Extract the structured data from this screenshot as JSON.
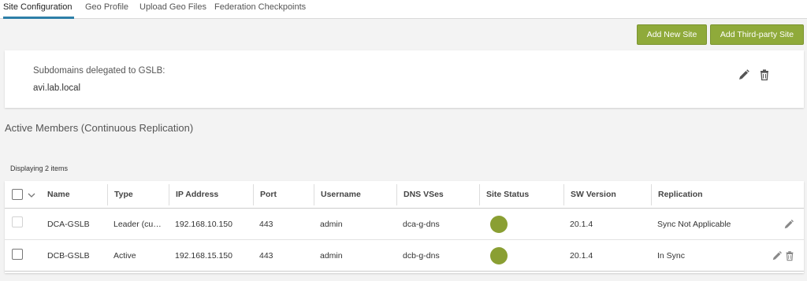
{
  "tabs": [
    {
      "label": "Site Configuration",
      "active": true
    },
    {
      "label": "Geo Profile",
      "active": false
    },
    {
      "label": "Upload Geo Files",
      "active": false
    },
    {
      "label": "Federation Checkpoints",
      "active": false
    }
  ],
  "actions": {
    "add_new_site": "Add New Site",
    "add_third_party_site": "Add Third-party Site"
  },
  "subdomains": {
    "label": "Subdomains delegated to GSLB:",
    "value": "avi.lab.local"
  },
  "section_title": "Active Members (Continuous Replication)",
  "display_count": "Displaying 2 items",
  "table": {
    "columns": [
      "Name",
      "Type",
      "IP Address",
      "Port",
      "Username",
      "DNS VSes",
      "Site Status",
      "SW Version",
      "Replication"
    ],
    "rows": [
      {
        "name": "DCA-GSLB",
        "type": "Leader (current)",
        "ip": "192.168.10.150",
        "port": "443",
        "username": "admin",
        "dns_vses": "dca-g-dns",
        "site_status": "up",
        "sw_version": "20.1.4",
        "replication": "Sync Not Applicable",
        "checkbox_disabled": true,
        "can_delete": false
      },
      {
        "name": "DCB-GSLB",
        "type": "Active",
        "ip": "192.168.15.150",
        "port": "443",
        "username": "admin",
        "dns_vses": "dcb-g-dns",
        "site_status": "up",
        "sw_version": "20.1.4",
        "replication": "In Sync",
        "checkbox_disabled": false,
        "can_delete": true
      }
    ]
  },
  "colors": {
    "accent_tab": "#2d7fa8",
    "button": "#8faa3a",
    "status_up": "#8a9f33"
  },
  "icons": [
    "pencil-icon",
    "trash-icon",
    "chevron-down-icon",
    "status-circle-icon"
  ]
}
